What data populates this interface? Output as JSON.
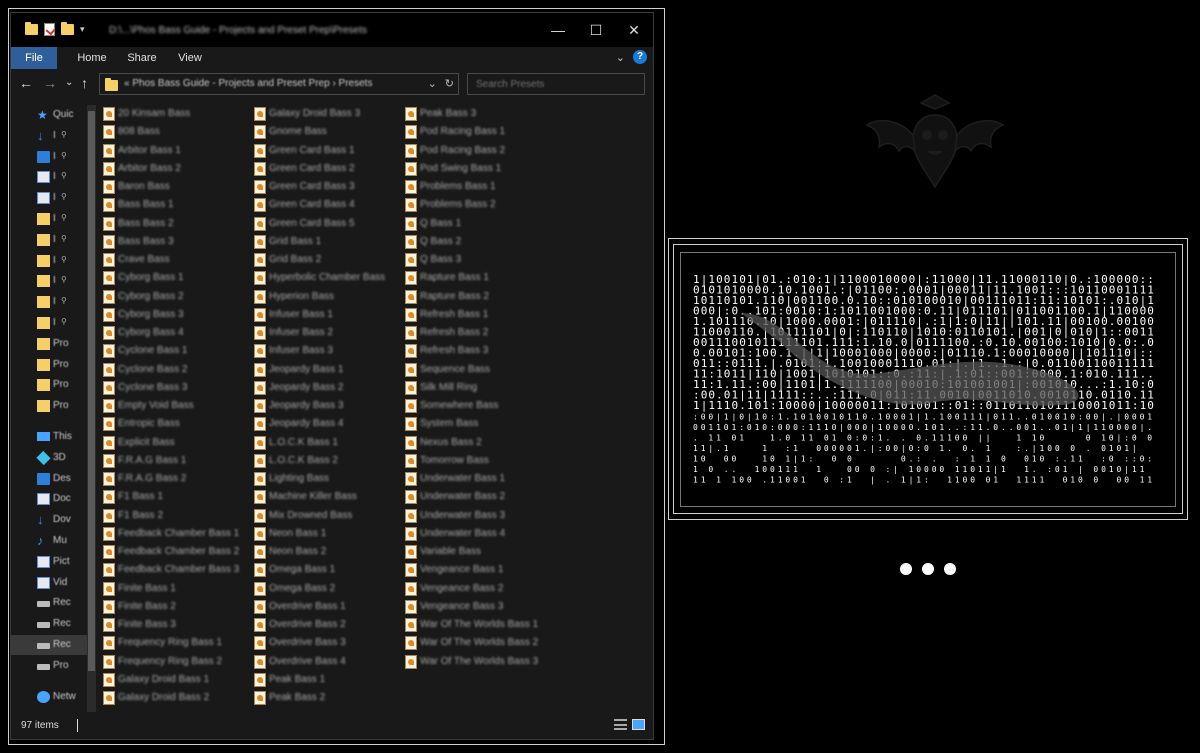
{
  "window": {
    "title": "D:\\...\\Phos Bass Guide - Projects and Preset Prep\\Presets",
    "controls": [
      "—",
      "☐",
      "✕"
    ]
  },
  "ribbon": {
    "tabs": [
      "File",
      "Home",
      "Share",
      "View"
    ],
    "help": "?"
  },
  "nav": {
    "back": "←",
    "forward": "→",
    "recent": "⌄",
    "up": "↑"
  },
  "address": {
    "path": "«  Phos Bass Guide - Projects and Preset Prep  ›  Presets",
    "dropdown": "⌄",
    "refresh": "↻"
  },
  "search": {
    "placeholder": "Search Presets"
  },
  "navpane": {
    "items": [
      {
        "label": "Quic",
        "icon": "star-icon",
        "pinned": false
      },
      {
        "label": "I",
        "icon": "downloads-icon",
        "pinned": true
      },
      {
        "label": "I",
        "icon": "desktop-icon",
        "pinned": true
      },
      {
        "label": "I",
        "icon": "documents-icon",
        "pinned": true
      },
      {
        "label": "I",
        "icon": "pictures-icon",
        "pinned": true
      },
      {
        "label": "I",
        "icon": "folder-icon",
        "pinned": true
      },
      {
        "label": "I",
        "icon": "folder-icon",
        "pinned": true
      },
      {
        "label": "I",
        "icon": "folder-icon",
        "pinned": true
      },
      {
        "label": "I",
        "icon": "folder-icon",
        "pinned": true
      },
      {
        "label": "I",
        "icon": "folder-icon",
        "pinned": true
      },
      {
        "label": "I",
        "icon": "folder-icon",
        "pinned": true
      },
      {
        "label": "Pro",
        "icon": "folder-icon",
        "pinned": false
      },
      {
        "label": "Pro",
        "icon": "folder-icon",
        "pinned": false
      },
      {
        "label": "Pro",
        "icon": "folder-icon",
        "pinned": false
      },
      {
        "label": "Pro",
        "icon": "folder-icon",
        "pinned": false
      },
      {
        "label": "This",
        "icon": "pc-icon",
        "pinned": false
      },
      {
        "label": "3D",
        "icon": "objects-3d-icon",
        "pinned": false
      },
      {
        "label": "Des",
        "icon": "desktop-icon",
        "pinned": false
      },
      {
        "label": "Doc",
        "icon": "documents-icon",
        "pinned": false
      },
      {
        "label": "Dov",
        "icon": "downloads-icon",
        "pinned": false
      },
      {
        "label": "Mu",
        "icon": "music-icon",
        "pinned": false
      },
      {
        "label": "Pict",
        "icon": "pictures-icon",
        "pinned": false
      },
      {
        "label": "Vid",
        "icon": "videos-icon",
        "pinned": false
      },
      {
        "label": "Rec",
        "icon": "drive-icon",
        "pinned": false
      },
      {
        "label": "Rec",
        "icon": "network-drive-icon",
        "pinned": false
      },
      {
        "label": "Rec",
        "icon": "drive-icon",
        "pinned": false,
        "selected": true
      },
      {
        "label": "Pro",
        "icon": "drive-icon",
        "pinned": false
      },
      {
        "label": "Netw",
        "icon": "network-icon",
        "pinned": false
      }
    ]
  },
  "files": [
    "20 Kinsam Bass",
    "808 Bass",
    "Arbitor Bass 1",
    "Arbitor Bass 2",
    "Baron Bass",
    "Bass Bass 1",
    "Bass Bass 2",
    "Bass Bass 3",
    "Crave Bass",
    "Cyborg Bass 1",
    "Cyborg Bass 2",
    "Cyborg Bass 3",
    "Cyborg Bass 4",
    "Cyclone Bass 1",
    "Cyclone Bass 2",
    "Cyclone Bass 3",
    "Empty Void Bass",
    "Entropic Bass",
    "Explicit Bass",
    "F.R.A.G Bass 1",
    "F.R.A.G Bass 2",
    "F1 Bass 1",
    "F1 Bass 2",
    "Feedback Chamber Bass 1",
    "Feedback Chamber Bass 2",
    "Feedback Chamber Bass 3",
    "Finite Bass 1",
    "Finite Bass 2",
    "Finite Bass 3",
    "Frequency Ring Bass 1",
    "Frequency Ring Bass 2",
    "Galaxy Droid Bass 1",
    "Galaxy Droid Bass 2",
    "Galaxy Droid Bass 3",
    "Gnome Bass",
    "Green Card Bass 1",
    "Green Card Bass 2",
    "Green Card Bass 3",
    "Green Card Bass 4",
    "Green Card Bass 5",
    "Grid Bass 1",
    "Grid Bass 2",
    "Hyperbolic Chamber Bass",
    "Hyperion Bass",
    "Infuser Bass 1",
    "Infuser Bass 2",
    "Infuser Bass 3",
    "Jeopardy Bass 1",
    "Jeopardy Bass 2",
    "Jeopardy Bass 3",
    "Jeopardy Bass 4",
    "L.O.C.K Bass 1",
    "L.O.C.K Bass 2",
    "Lighting Bass",
    "Machine Killer Bass",
    "Mix Drowned Bass",
    "Neon Bass 1",
    "Neon Bass 2",
    "Omega Bass 1",
    "Omega Bass 2",
    "Overdrive Bass 1",
    "Overdrive Bass 2",
    "Overdrive Bass 3",
    "Overdrive Bass 4",
    "Peak Bass 1",
    "Peak Bass 2",
    "Peak Bass 3",
    "Pod Racing Bass 1",
    "Pod Racing Bass 2",
    "Pod Swing Bass 1",
    "Problems Bass 1",
    "Problems Bass 2",
    "Q Bass 1",
    "Q Bass 2",
    "Q Bass 3",
    "Rapture Bass 1",
    "Rapture Bass 2",
    "Refresh Bass 1",
    "Refresh Bass 2",
    "Refresh Bass 3",
    "Sequence Bass",
    "Silk Mill Ring",
    "Somewhere Bass",
    "System Bass",
    "Nexus Bass 2",
    "Tomorrow Bass",
    "Underwater Bass 1",
    "Underwater Bass 2",
    "Underwater Bass 3",
    "Underwater Bass 4",
    "Variable Bass",
    "Vengeance Bass 1",
    "Vengeance Bass 2",
    "Vengeance Bass 3",
    "War Of The Worlds Bass 1",
    "War Of The Worlds Bass 2",
    "War Of The Worlds Bass 3"
  ],
  "status": {
    "count": "97 items"
  },
  "colors": {
    "window_bg": "#191919",
    "file_tab": "#2f5f9a",
    "accent_blue": "#1a7ad4",
    "folder_yellow": "#f5d06a"
  }
}
